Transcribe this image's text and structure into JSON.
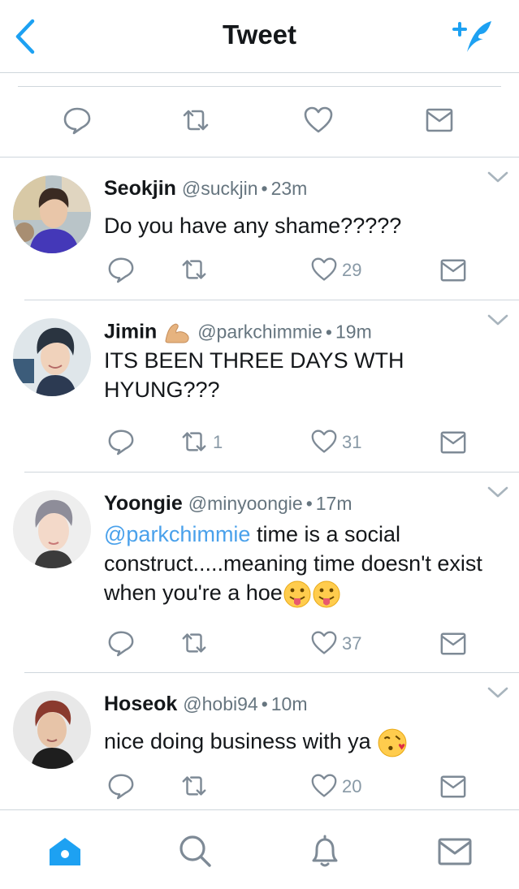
{
  "nav": {
    "title": "Tweet",
    "back_icon": "chevron-left-icon",
    "compose_icon": "compose-tweet-icon"
  },
  "colors": {
    "accent": "#1da1f2",
    "mention": "#4aa1eb",
    "gray": "#66757f",
    "icon": "#7e8a96"
  },
  "tweets": [
    {
      "name": "Seokjin",
      "handle": "@suckjin",
      "separator": "•",
      "time": "23m",
      "text": "Do you have any shame?????",
      "likes": "29"
    },
    {
      "name": "Jimin",
      "handle": "@parkchimmie",
      "separator": "•",
      "time": "19m",
      "text": "ITS BEEN THREE DAYS WTH HYUNG???",
      "retweets": "1",
      "likes": "31"
    },
    {
      "name": "Yoongie",
      "handle": "@minyoongie",
      "separator": "•",
      "time": "17m",
      "mention": "@parkchimmie",
      "text": " time is a social construct.....meaning time doesn't exist when you're a hoe",
      "likes": "37"
    },
    {
      "name": "Hoseok",
      "handle": "@hobi94",
      "separator": "•",
      "time": "10m",
      "text": "nice doing business with ya",
      "likes": "20"
    }
  ],
  "tabbar": {
    "items": [
      "home-icon",
      "search-icon",
      "notifications-icon",
      "messages-icon"
    ],
    "active": "home-icon"
  }
}
